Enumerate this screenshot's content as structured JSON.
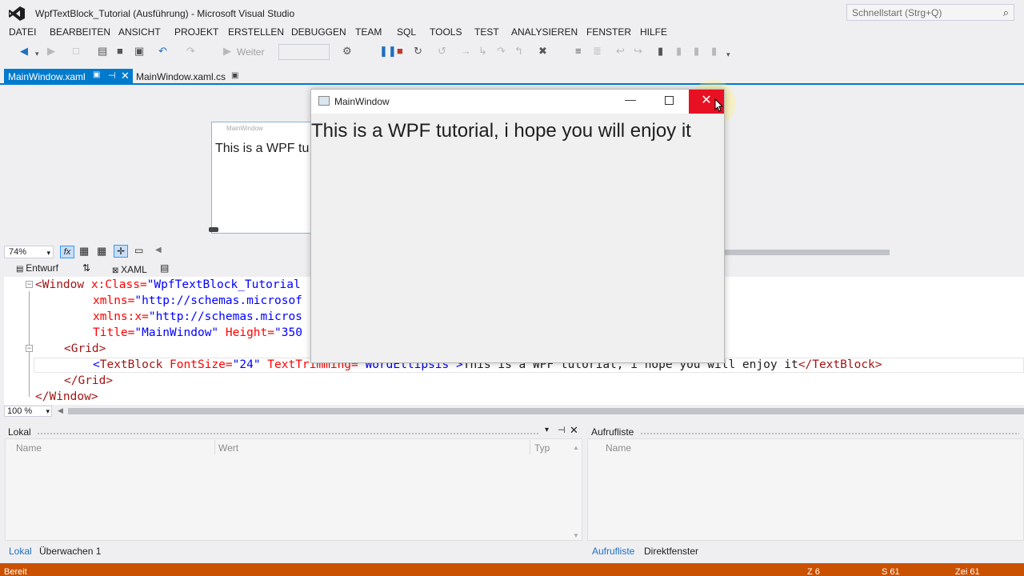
{
  "window": {
    "title": "WpfTextBlock_Tutorial (Ausführung) - Microsoft Visual Studio"
  },
  "quick_launch": {
    "placeholder": "Schnellstart (Strg+Q)",
    "icon": "search-icon"
  },
  "menu": [
    "DATEI",
    "BEARBEITEN",
    "ANSICHT",
    "PROJEKT",
    "ERSTELLEN",
    "DEBUGGEN",
    "TEAM",
    "SQL",
    "TOOLS",
    "TEST",
    "ANALYSIEREN",
    "FENSTER",
    "HILFE"
  ],
  "toolbar": {
    "continue_label": "Weiter"
  },
  "doc_tabs": [
    {
      "label": "MainWindow.xaml",
      "active": true
    },
    {
      "label": "MainWindow.xaml.cs",
      "active": false
    }
  ],
  "designer": {
    "window_title": "MainWindow",
    "preview_text": "This is a WPF tu",
    "zoom": "74%",
    "tab_design": "Entwurf",
    "tab_xaml": "XAML"
  },
  "code": {
    "line1_tag": "<Window",
    "line1_attr": " x:Class=",
    "line1_val": "\"WpfTextBlock_Tutorial",
    "line2_attr": "xmlns=",
    "line2_val": "\"http://schemas.microsof",
    "line3_attr": "xmlns:x=",
    "line3_val": "\"http://schemas.micros",
    "line4_attr": "Title=",
    "line4_val": "\"MainWindow\"",
    "line4_attr2": " Height=",
    "line4_val2": "\"350",
    "line5_tag": "<Grid>",
    "line6_open": "<",
    "line6_tag": "TextBlock",
    "line6_attr": " FontSize=",
    "line6_val": "\"24\"",
    "line6_attr2": " TextTrimming=",
    "line6_val2": "\"WordEllipsis\"",
    "line6_gt": ">",
    "line6_text": "This is a WPF tutorial, i hope you will enjoy it",
    "line6_close": "</TextBlock>",
    "line7_tag": "</Grid>",
    "line8_tag": "</Window>",
    "zoom": "100 %"
  },
  "wpf_window": {
    "title": "MainWindow",
    "content": "This is a WPF tutorial, i hope you will enjoy it"
  },
  "locals_panel": {
    "title": "Lokal",
    "columns": [
      "Name",
      "Wert",
      "Typ"
    ],
    "tabs": [
      "Lokal",
      "Überwachen 1"
    ]
  },
  "callstack_panel": {
    "title": "Aufrufliste",
    "columns": [
      "Name"
    ],
    "tabs": [
      "Aufrufliste",
      "Direktfenster"
    ]
  },
  "status": {
    "state": "Bereit",
    "line": "Z 6",
    "col": "S 61",
    "char": "Zei 61"
  },
  "colors": {
    "accent": "#007acc",
    "status_bar": "#ca5100",
    "close_button": "#e81123"
  }
}
